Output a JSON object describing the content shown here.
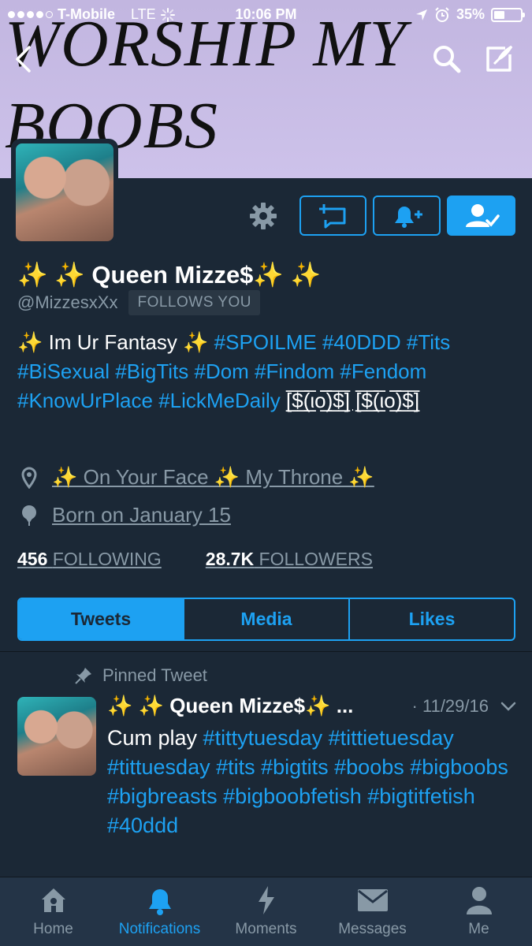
{
  "status_bar": {
    "carrier": "T-Mobile",
    "network": "LTE",
    "time": "10:06 PM",
    "battery_text": "35%",
    "battery_level": 0.35
  },
  "banner": {
    "line1": "WORSHIP MY",
    "line2": "BOOBS"
  },
  "profile": {
    "name": "✨ ✨  Queen Mizze$✨ ✨",
    "handle": "@MizzesxXx",
    "follows_you": "FOLLOWS YOU",
    "bio_prefix": "✨  Im Ur Fantasy ✨ ",
    "bio_tags_1": "#SPOILME #40DDD #Tits #BiSexual #BigTits #Dom #Findom #Fendom #KnowUrPlace #LickMeDaily",
    "bio_money": "[̲̅$̲̅(̲̅ιο̲̅̅)̲̅$̲̅] [̲̅$̲̅(̲̅ιο̲̅̅)̲̅$̲̅]",
    "location": "✨  On Your Face ✨  My Throne ✨",
    "birthday": "Born on January 15",
    "following_count": "456",
    "following_label": "FOLLOWING",
    "followers_count": "28.7K",
    "followers_label": "FOLLOWERS"
  },
  "tabs": [
    {
      "label": "Tweets",
      "active": true
    },
    {
      "label": "Media",
      "active": false
    },
    {
      "label": "Likes",
      "active": false
    }
  ],
  "pinned_tweet": {
    "pinned_label": "Pinned Tweet",
    "author": "✨ ✨  Queen Mizze$✨ ...",
    "date": "· 11/29/16",
    "text_plain": "Cum play ",
    "text_tags": "#tittytuesday #tittietuesday #tittuesday #tits #bigtits #boobs #bigboobs #bigbreasts #bigboobfetish #bigtitfetish #40ddd"
  },
  "tab_bar": [
    {
      "label": "Home",
      "icon": "home-icon",
      "active": false
    },
    {
      "label": "Notifications",
      "icon": "bell-icon",
      "active": true
    },
    {
      "label": "Moments",
      "icon": "lightning-icon",
      "active": false
    },
    {
      "label": "Messages",
      "icon": "envelope-icon",
      "active": false
    },
    {
      "label": "Me",
      "icon": "person-icon",
      "active": false
    }
  ],
  "colors": {
    "background": "#1b2836",
    "accent": "#1da1f2",
    "muted": "#8899a6",
    "banner": "#c2b6e0"
  }
}
